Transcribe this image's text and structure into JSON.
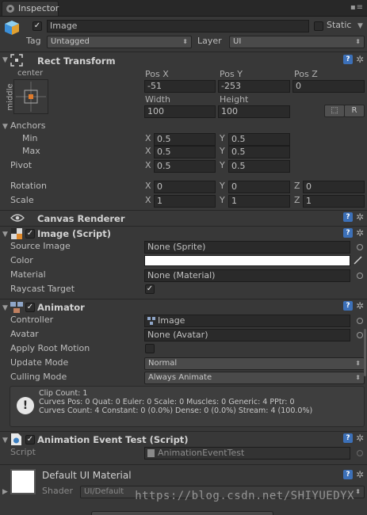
{
  "tab": {
    "title": "Inspector",
    "menu": "▪≡"
  },
  "object": {
    "active": true,
    "name": "Image",
    "static_label": "Static",
    "static": false,
    "tag_label": "Tag",
    "tag_value": "Untagged",
    "layer_label": "Layer",
    "layer_value": "UI"
  },
  "rect": {
    "title": "Rect Transform",
    "anchor_h": "center",
    "anchor_v": "middle",
    "cols": {
      "a": "Pos X",
      "b": "Pos Y",
      "c": "Pos Z",
      "w": "Width",
      "h": "Height"
    },
    "pos_x": "-51",
    "pos_y": "-253",
    "pos_z": "0",
    "width": "100",
    "height": "100",
    "blueprint_btn": "⬚",
    "raw_btn": "R",
    "anchors_label": "Anchors",
    "min_label": "Min",
    "max_label": "Max",
    "pivot_label": "Pivot",
    "min_x": "0.5",
    "min_y": "0.5",
    "max_x": "0.5",
    "max_y": "0.5",
    "pivot_x": "0.5",
    "pivot_y": "0.5",
    "rotation_label": "Rotation",
    "scale_label": "Scale",
    "rot_x": "0",
    "rot_y": "0",
    "rot_z": "0",
    "scale_x": "1",
    "scale_y": "1",
    "scale_z": "1",
    "axis_x": "X",
    "axis_y": "Y",
    "axis_z": "Z"
  },
  "canvas_renderer": {
    "title": "Canvas Renderer"
  },
  "image_script": {
    "title": "Image (Script)",
    "source_label": "Source Image",
    "source_value": "None (Sprite)",
    "color_label": "Color",
    "color_value": "#ffffff",
    "material_label": "Material",
    "material_value": "None (Material)",
    "raycast_label": "Raycast Target",
    "raycast": true
  },
  "animator": {
    "title": "Animator",
    "controller_label": "Controller",
    "controller_value": "Image",
    "avatar_label": "Avatar",
    "avatar_value": "None (Avatar)",
    "root_motion_label": "Apply Root Motion",
    "update_label": "Update Mode",
    "update_value": "Normal",
    "culling_label": "Culling Mode",
    "culling_value": "Always Animate",
    "info": [
      "Clip Count: 1",
      "Curves Pos: 0 Quat: 0 Euler: 0 Scale: 0 Muscles: 0 Generic: 4 PPtr: 0",
      "Curves Count: 4 Constant: 0 (0.0%) Dense: 0 (0.0%) Stream: 4 (100.0%)"
    ],
    "info_icon": "!"
  },
  "event_test": {
    "title": "Animation Event Test (Script)",
    "script_label": "Script",
    "script_value": "AnimationEventTest"
  },
  "material": {
    "title": "Default UI Material",
    "shader_label": "Shader",
    "shader_value": "UI/Default"
  },
  "icons": {
    "help": "?",
    "gear": "✲",
    "fold_open": "▼",
    "fold_closed": "▶",
    "check": "✓"
  },
  "watermark": "https://blog.csdn.net/SHIYUEDYX"
}
